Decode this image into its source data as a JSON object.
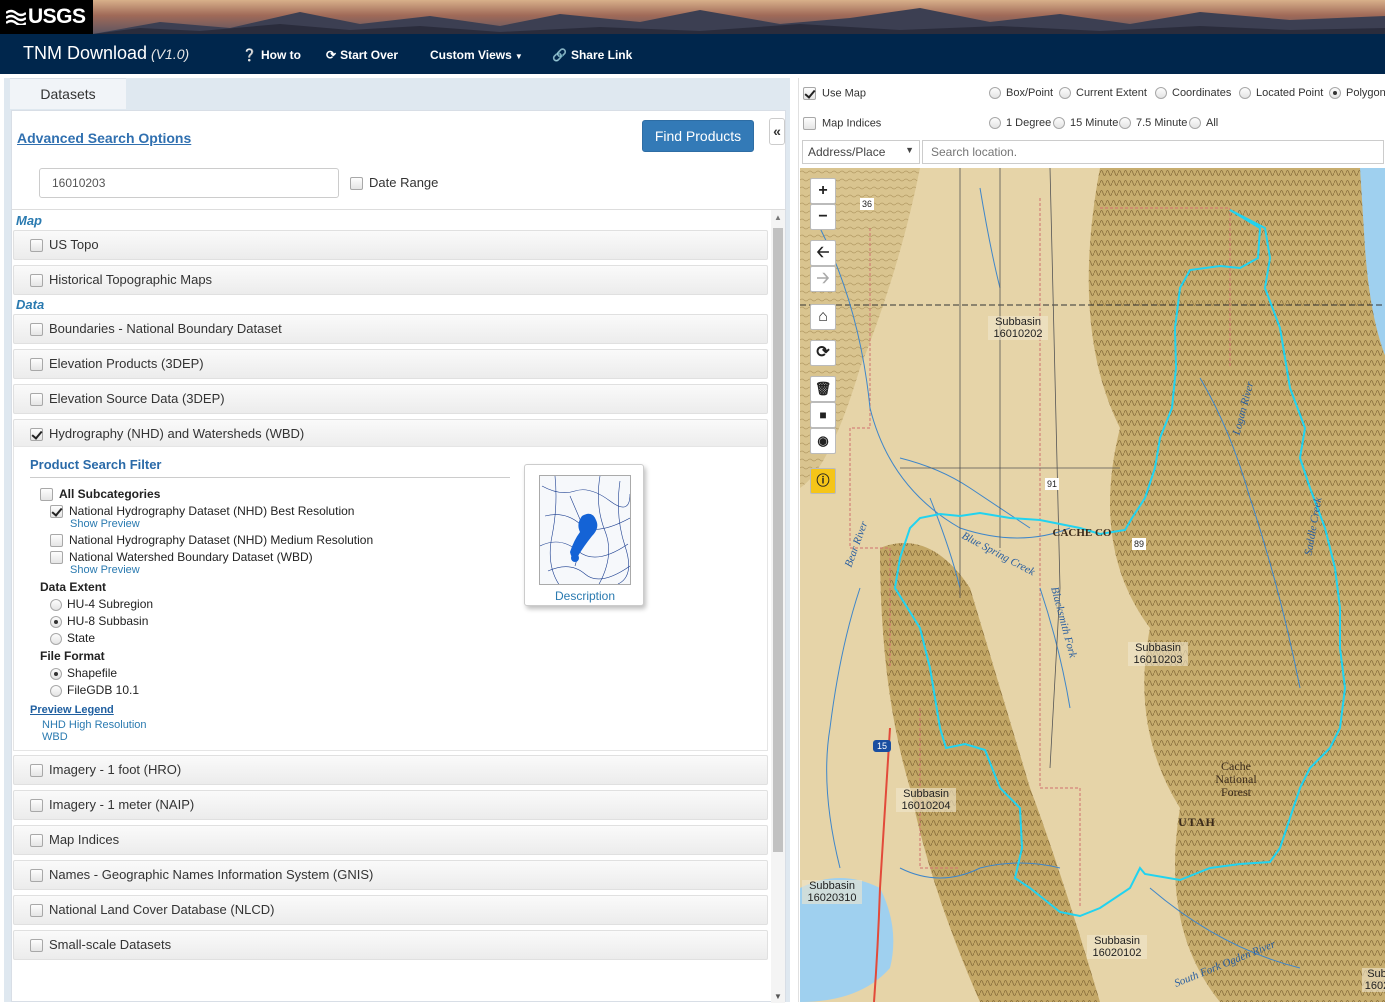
{
  "banner": {
    "logo_text": "USGS"
  },
  "navbar": {
    "title": "TNM Download",
    "version": "(V1.0)",
    "items": [
      {
        "label": "How to",
        "icon": "question-circle-icon"
      },
      {
        "label": "Start Over",
        "icon": "refresh-icon"
      },
      {
        "label": "Custom Views",
        "icon": "caret-down-icon"
      },
      {
        "label": "Share Link",
        "icon": "link-icon"
      }
    ]
  },
  "left": {
    "tab_label": "Datasets",
    "advanced_search": "Advanced Search Options",
    "find_products": "Find Products",
    "collapse_icon": "«",
    "search_value": "16010203",
    "date_range_label": "Date Range",
    "section_map": "Map",
    "section_data": "Data",
    "map_datasets": [
      {
        "label": "US Topo",
        "checked": false
      },
      {
        "label": "Historical Topographic Maps",
        "checked": false
      }
    ],
    "data_datasets": [
      {
        "label": "Boundaries - National Boundary Dataset",
        "checked": false
      },
      {
        "label": "Elevation Products (3DEP)",
        "checked": false
      },
      {
        "label": "Elevation Source Data (3DEP)",
        "checked": false
      },
      {
        "label": "Hydrography (NHD) and Watersheds (WBD)",
        "checked": true
      }
    ],
    "more_datasets": [
      {
        "label": "Imagery - 1 foot (HRO)",
        "checked": false
      },
      {
        "label": "Imagery - 1 meter (NAIP)",
        "checked": false
      },
      {
        "label": "Map Indices",
        "checked": false
      },
      {
        "label": "Names - Geographic Names Information System (GNIS)",
        "checked": false
      },
      {
        "label": "National Land Cover Database (NLCD)",
        "checked": false
      },
      {
        "label": "Small-scale Datasets",
        "checked": false
      }
    ],
    "filter": {
      "title": "Product Search Filter",
      "all_subcategories": "All Subcategories",
      "subcategories": [
        {
          "label": "National Hydrography Dataset (NHD) Best Resolution",
          "checked": true
        },
        {
          "label": "National Hydrography Dataset (NHD) Medium Resolution",
          "checked": false
        },
        {
          "label": "National Watershed Boundary Dataset (WBD)",
          "checked": false
        }
      ],
      "show_preview": "Show Preview",
      "data_extent_label": "Data Extent",
      "data_extent_options": [
        {
          "label": "HU-4 Subregion",
          "selected": false
        },
        {
          "label": "HU-8 Subbasin",
          "selected": true
        },
        {
          "label": "State",
          "selected": false
        }
      ],
      "file_format_label": "File Format",
      "file_format_options": [
        {
          "label": "Shapefile",
          "selected": true
        },
        {
          "label": "FileGDB 10.1",
          "selected": false
        }
      ],
      "preview_legend": "Preview Legend",
      "legend_items": [
        "NHD High Resolution",
        "WBD"
      ],
      "description": "Description"
    }
  },
  "right": {
    "use_map": "Use Map",
    "use_map_checked": true,
    "map_indices": "Map Indices",
    "area_options": [
      "Box/Point",
      "Current Extent",
      "Coordinates",
      "Located Point",
      "Polygon"
    ],
    "area_selected": "Polygon",
    "index_options": [
      "1 Degree",
      "15 Minute",
      "7.5 Minute",
      "All"
    ],
    "address_select": "Address/Place",
    "search_placeholder": "Search location.",
    "map_buttons": [
      "zoom-in-icon",
      "zoom-out-icon",
      "back-arrow-icon",
      "forward-arrow-icon",
      "home-icon",
      "reload-icon",
      "trash-icon",
      "square-icon",
      "pin-icon",
      "info-icon"
    ],
    "map_labels": {
      "sb_16010202": "Subbasin\n16010202",
      "sb_16010203": "Subbasin\n16010203",
      "sb_16010204": "Subbasin\n16010204",
      "sb_16020310": "Subbasin\n16020310",
      "sb_16020102": "Subbasin\n16020102",
      "sb_partial": "Sub\n1602",
      "cache_forest": "Cache\nNational\nForest",
      "utah": "UTAH",
      "cache_county": "CACHE CO",
      "blue_spring": "Blue Spring Creek",
      "logan_river": "Logan River",
      "saddle_creek": "Saddle Creek",
      "bear_river": "Bear River",
      "blacksmith": "Blacksmith Fork",
      "ogden_river": "South Fork Ogden River",
      "hwy_15": "15",
      "hwy_89": "89",
      "hwy_91": "91",
      "hwy_36": "36"
    }
  }
}
